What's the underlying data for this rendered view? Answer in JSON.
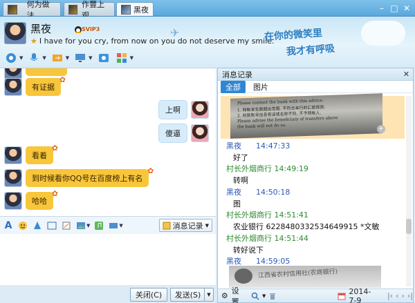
{
  "tabs": [
    {
      "label": "何为做法"
    },
    {
      "label": "作豐上观"
    },
    {
      "label": "黑夜"
    }
  ],
  "window_buttons": [
    "–",
    "□",
    "✕"
  ],
  "header": {
    "contact_name": "黑夜",
    "badge_text": "SVIP3",
    "signature": "I have for you cry, from now on you do not deserve my smile.",
    "decor_line1": "在你的微笑里",
    "decor_line2": "我才有呼吸"
  },
  "chat": {
    "messages": [
      {
        "side": "left",
        "text": "有证据"
      },
      {
        "side": "right",
        "text": "上啊"
      },
      {
        "side": "right",
        "text": "傻逼"
      },
      {
        "side": "left",
        "text": "看着"
      },
      {
        "side": "left",
        "text": "到时候看你QQ号在百度榜上有名"
      },
      {
        "side": "left",
        "text": "哈哈"
      }
    ]
  },
  "input_bar": {
    "history_label": "消息记录"
  },
  "buttons": {
    "close_label": "关闭(C)",
    "send_label": "发送(S)"
  },
  "history": {
    "title": "消息记录",
    "tabs": [
      "全部",
      "图片"
    ],
    "image_text_lines": [
      "Please contact the bank with this advice.",
      "1. 转帐发生额超出范围. 不符合本行的汇款规则.",
      "2. 收款账号信息有误或名称不符, 不予转帐人.",
      "Please advise the beneficiary of transfers above",
      "the bank will not do so."
    ],
    "entries": [
      {
        "sender": "黑夜",
        "time": "14:47:33",
        "type": "self",
        "body": "好了"
      },
      {
        "sender": "村长外烟商行",
        "time": "14:49:19",
        "type": "other",
        "body": "转啊"
      },
      {
        "sender": "黑夜",
        "time": "14:50:18",
        "type": "self",
        "body": "图"
      },
      {
        "sender": "村长外烟商行",
        "time": "14:51:41",
        "type": "other",
        "body": "农业银行 6228480332534649915 *文敏"
      },
      {
        "sender": "村长外烟商行",
        "time": "14:51:44",
        "type": "other",
        "body": "转好说下"
      },
      {
        "sender": "黑夜",
        "time": "14:59:05",
        "type": "self",
        "body": ""
      }
    ],
    "photo2_text": "江西省农村信用社(农商银行)",
    "footer": {
      "settings_label": "设置",
      "date": "2014-7-9"
    }
  }
}
